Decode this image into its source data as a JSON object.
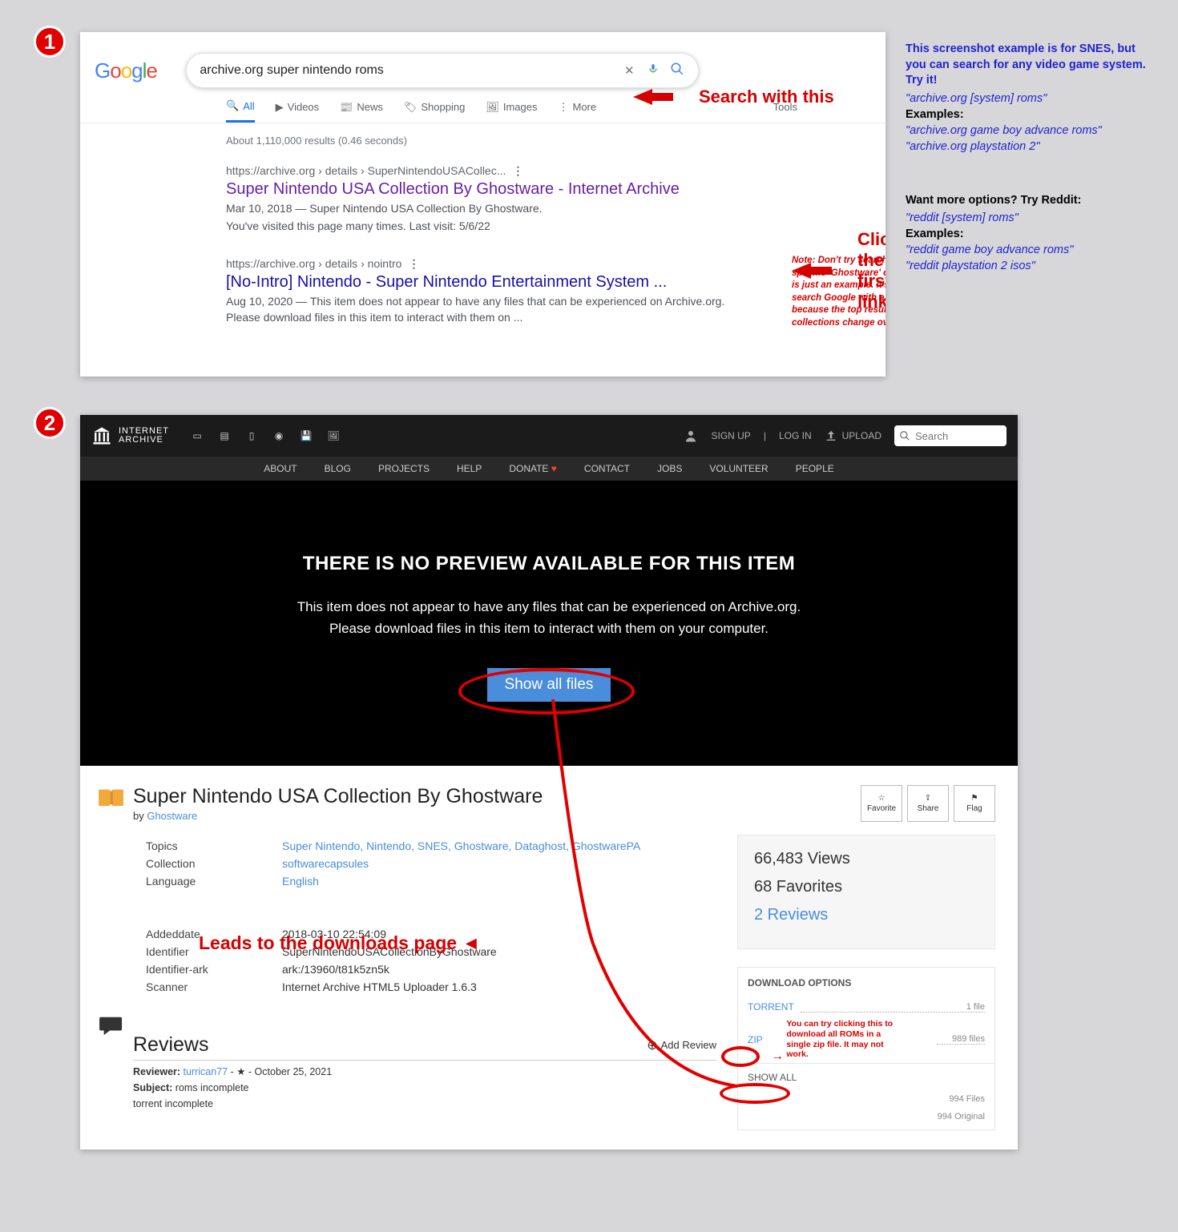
{
  "badges": {
    "one": "1",
    "two": "2"
  },
  "sidebar": {
    "intro": "This screenshot example is for SNES, but you can search for any video game system. Try it!",
    "pattern1": "\"archive.org [system] roms\"",
    "examples_label": "Examples:",
    "ex1": "\"archive.org game boy advance roms\"",
    "ex2": "\"archive.org playstation 2\"",
    "more": "Want more options? Try Reddit:",
    "pattern2": "\"reddit [system] roms\"",
    "ex3": "\"reddit game boy advance roms\"",
    "ex4": "\"reddit playstation 2 isos\""
  },
  "google": {
    "query": "archive.org super nintendo roms",
    "callout_search": "Search with this",
    "callout_click": "Click the first link",
    "note": "Note: Don't try searching for this specific 'Ghostware' collection. This is just an example. It's better to search Google with a general query because the top result for rom collections change over time.",
    "tabs": {
      "all": "All",
      "videos": "Videos",
      "news": "News",
      "shopping": "Shopping",
      "images": "Images",
      "more": "More",
      "tools": "Tools"
    },
    "result_meta": "About 1,110,000 results (0.46 seconds)",
    "r1": {
      "crumb": "https://archive.org › details › SuperNintendoUSACollec...",
      "title": "Super Nintendo USA Collection By Ghostware - Internet Archive",
      "line1": "Mar 10, 2018 — Super Nintendo USA Collection By Ghostware.",
      "line2": "You've visited this page many times. Last visit: 5/6/22"
    },
    "r2": {
      "crumb": "https://archive.org › details › nointro",
      "title": "[No-Intro] Nintendo - Super Nintendo Entertainment System ...",
      "line": "Aug 10, 2020 — This item does not appear to have any files that can be experienced on Archive.org. Please download files in this item to interact with them on ..."
    }
  },
  "archive": {
    "logo_top": "INTERNET",
    "logo_bottom": "ARCHIVE",
    "signup": "SIGN UP",
    "login": "LOG IN",
    "upload": "UPLOAD",
    "search_ph": "Search",
    "nav": {
      "about": "ABOUT",
      "blog": "BLOG",
      "projects": "PROJECTS",
      "help": "HELP",
      "donate": "DONATE",
      "contact": "CONTACT",
      "jobs": "JOBS",
      "volunteer": "VOLUNTEER",
      "people": "PEOPLE"
    },
    "nopreview": "THERE IS NO PREVIEW AVAILABLE FOR THIS ITEM",
    "msg1": "This item does not appear to have any files that can be experienced on Archive.org.",
    "msg2": "Please download files in this item to interact with them on your computer.",
    "show_btn": "Show all files",
    "item_title": "Super Nintendo USA Collection By Ghostware",
    "by_prefix": "by ",
    "by_link": "Ghostware",
    "topics_label": "Topics",
    "topics": "Super Nintendo, Nintendo, SNES, Ghostware, Dataghost, GhostwarePA",
    "collection_label": "Collection",
    "collection": "softwarecapsules",
    "language_label": "Language",
    "language": "English",
    "added_label": "Addeddate",
    "added": "2018-03-10 22:54:09",
    "ident_label": "Identifier",
    "ident": "SuperNintendoUSACollectionByGhostware",
    "identark_label": "Identifier-ark",
    "identark": "ark:/13960/t81k5zn5k",
    "scanner_label": "Scanner",
    "scanner": "Internet Archive HTML5 Uploader 1.6.3",
    "reviews_h": "Reviews",
    "add_review": "Add Review",
    "reviewer_prefix": "Reviewer: ",
    "reviewer": "turrican77",
    "review_meta": " - ★ - October 25, 2021",
    "subject_prefix": "Subject: ",
    "subject": "roms incomplete",
    "review_body": "torrent incomplete",
    "fav_btn": "Favorite",
    "share_btn": "Share",
    "flag_btn": "Flag",
    "views": "66,483 Views",
    "favs": "68 Favorites",
    "reviews_ct": "2 Reviews",
    "dl_h": "DOWNLOAD OPTIONS",
    "dl_torrent": "TORRENT",
    "dl_torrent_ct": "1 file",
    "dl_zip": "ZIP",
    "dl_zip_ct": "989 files",
    "dl_showall": "SHOW ALL",
    "dl_m1": "994 Files",
    "dl_m2": "994 Original",
    "zip_note": "You can try clicking this to download all ROMs in a single zip file. It may not work.",
    "leads": "Leads to the downloads page"
  }
}
